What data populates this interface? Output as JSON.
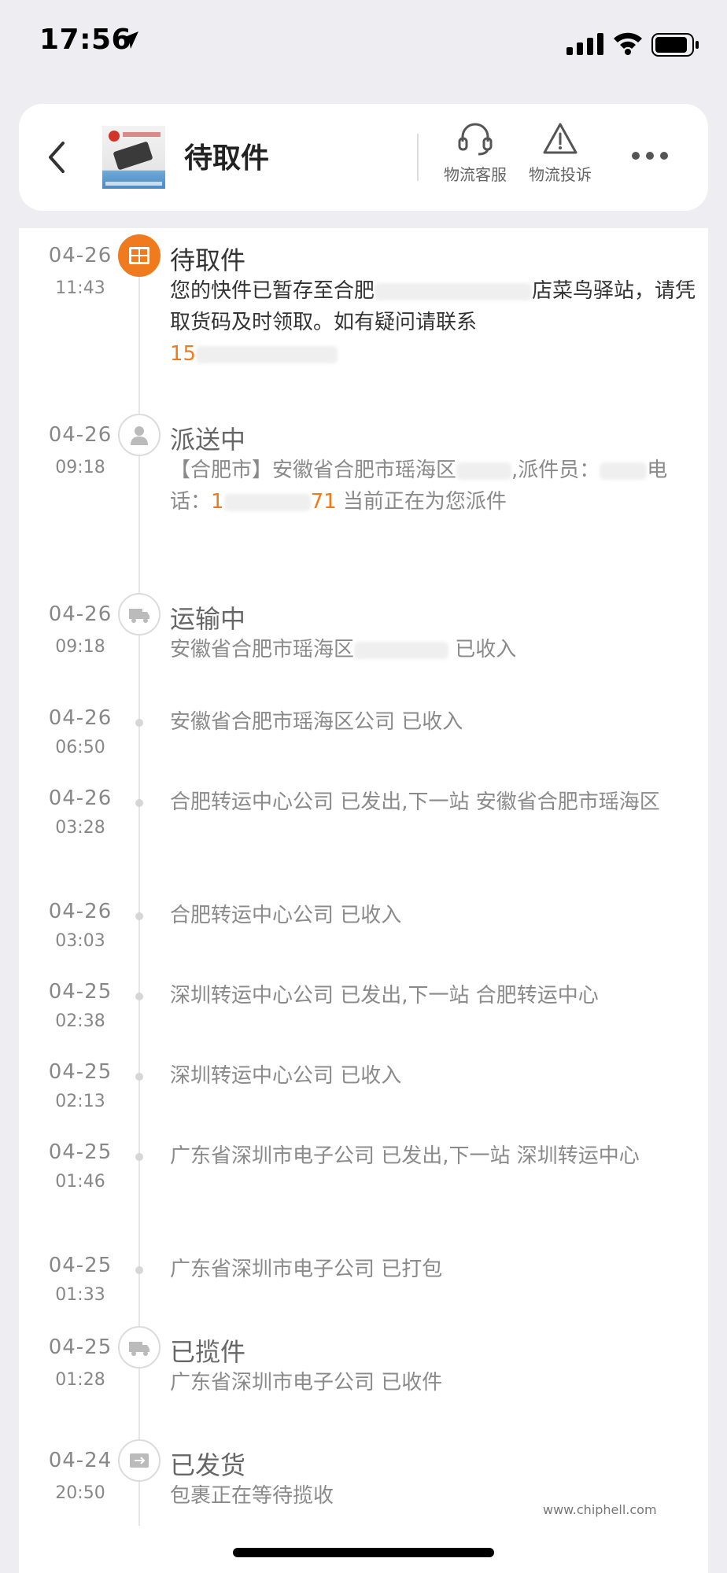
{
  "status_bar": {
    "time": "17:56"
  },
  "header": {
    "title": "待取件",
    "actions": [
      {
        "label": "物流客服",
        "icon": "headset-icon"
      },
      {
        "label": "物流投诉",
        "icon": "warning-icon"
      }
    ]
  },
  "events": [
    {
      "date": "04-26",
      "time": "11:43",
      "title": "待取件",
      "desc_a": "您的快件已暂存至合肥",
      "desc_b": "店菜鸟驿站，请凭取货码及时领取。如有疑问请联系",
      "phone": "15",
      "status": "active"
    },
    {
      "date": "04-26",
      "time": "09:18",
      "title": "派送中",
      "desc_a": "【合肥市】安徽省合肥市瑶海区",
      "desc_b": ",派件员：",
      "desc_c": "电话：",
      "phone": "1",
      "phone_tail": "71",
      "desc_d": "当前正在为您派件"
    },
    {
      "date": "04-26",
      "time": "09:18",
      "title": "运输中",
      "desc_a": "安徽省合肥市瑶海区",
      "desc_b": "已收入"
    },
    {
      "date": "04-26",
      "time": "06:50",
      "desc": "安徽省合肥市瑶海区公司 已收入"
    },
    {
      "date": "04-26",
      "time": "03:28",
      "desc": "合肥转运中心公司 已发出,下一站 安徽省合肥市瑶海区"
    },
    {
      "date": "04-26",
      "time": "03:03",
      "desc": "合肥转运中心公司 已收入"
    },
    {
      "date": "04-25",
      "time": "02:38",
      "desc": "深圳转运中心公司 已发出,下一站 合肥转运中心"
    },
    {
      "date": "04-25",
      "time": "02:13",
      "desc": "深圳转运中心公司 已收入"
    },
    {
      "date": "04-25",
      "time": "01:46",
      "desc": "广东省深圳市电子公司 已发出,下一站 深圳转运中心"
    },
    {
      "date": "04-25",
      "time": "01:33",
      "desc": "广东省深圳市电子公司 已打包"
    },
    {
      "date": "04-25",
      "time": "01:28",
      "title": "已揽件",
      "desc": "广东省深圳市电子公司 已收件"
    },
    {
      "date": "04-24",
      "time": "20:50",
      "title": "已发货",
      "desc": "包裹正在等待揽收"
    }
  ],
  "watermark": "www.chiphell.com",
  "colors": {
    "accent": "#f07a1e",
    "background": "#eeeef2"
  }
}
